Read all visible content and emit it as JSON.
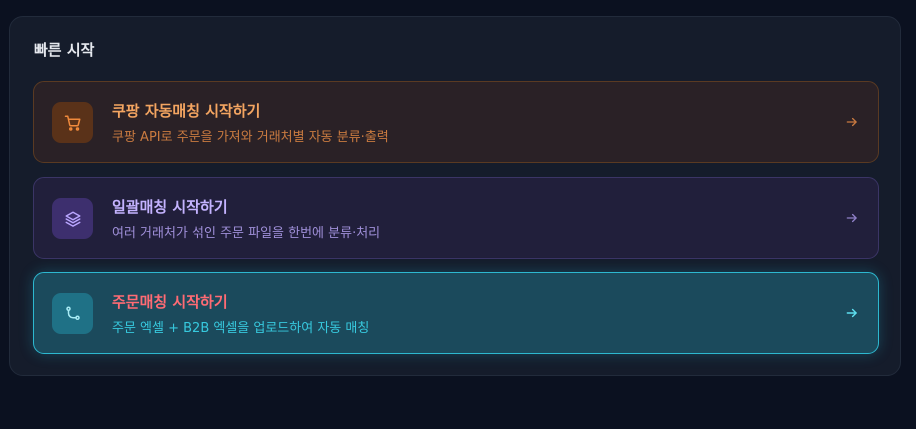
{
  "panel": {
    "title": "빠른 시작"
  },
  "cards": [
    {
      "title": "쿠팡 자동매칭 시작하기",
      "description": "쿠팡 API로 주문을 가져와 거래처별 자동 분류·출력",
      "icon": "cart-icon",
      "accent": "#f4a561"
    },
    {
      "title": "일괄매칭 시작하기",
      "description": "여러 거래처가 섞인 주문 파일을 한번에 분류·처리",
      "icon": "layers-icon",
      "accent": "#c4b3ff"
    },
    {
      "title": "주문매칭 시작하기",
      "description": "주문 엑셀 + B2B 엑셀을 업로드하여 자동 매칭",
      "icon": "git-branch-icon",
      "accent": "#ff6b74"
    }
  ]
}
